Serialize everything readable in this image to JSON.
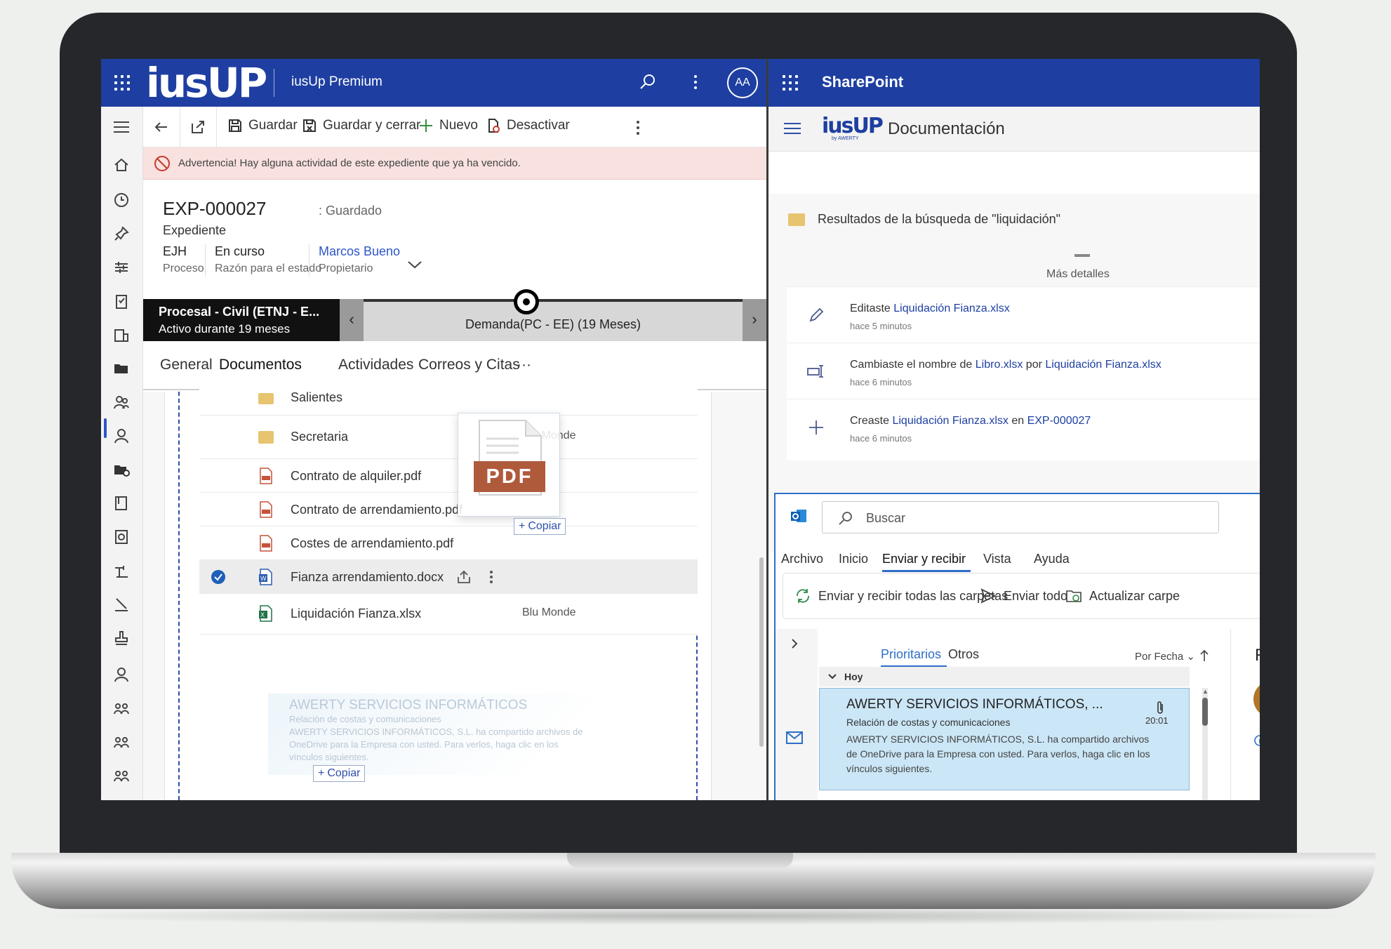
{
  "left_app": {
    "logo": "iusUP",
    "app_name": "iusUp Premium",
    "avatar_initials": "AA",
    "toolbar": {
      "save": "Guardar",
      "save_close": "Guardar y cerrar",
      "new": "Nuevo",
      "deactivate": "Desactivar"
    },
    "warning": "Advertencia! Hay alguna actividad de este expediente que ya ha vencido.",
    "record": {
      "id": "EXP-000027",
      "status": ": Guardado",
      "type": "Expediente",
      "fields": [
        {
          "value": "EJH",
          "label": "Proceso"
        },
        {
          "value": "En curso",
          "label": "Razón para el estado"
        },
        {
          "value": "Marcos Bueno",
          "label": "Propietario"
        }
      ]
    },
    "process_flow": {
      "stage_title": "Procesal - Civil (ETNJ - E...",
      "stage_subtitle": "Activo durante 19 meses",
      "current": "Demanda(PC - EE)  (19 Meses)"
    },
    "tabs": [
      "General",
      "Documentos",
      "Actividades",
      "Correos y Citas",
      "···"
    ],
    "documents": [
      {
        "name": "Salientes",
        "type": "folder",
        "owner": ""
      },
      {
        "name": "Secretaria",
        "type": "folder",
        "owner": "Blu Monde"
      },
      {
        "name": "Contrato de alquiler.pdf",
        "type": "pdf",
        "owner": ""
      },
      {
        "name": "Contrato de arrendamiento.pdf",
        "type": "pdf",
        "owner": ""
      },
      {
        "name": "Costes de arrendamiento.pdf",
        "type": "pdf",
        "owner": ""
      },
      {
        "name": "Fianza arrendamiento.docx",
        "type": "docx",
        "owner": ""
      },
      {
        "name": "Liquidación Fianza.xlsx",
        "type": "xlsx",
        "owner": "Blu Monde"
      }
    ],
    "drag_pdf": {
      "badge": "PDF",
      "copy_label": "Copiar"
    },
    "drag_email": {
      "title": "AWERTY SERVICIOS INFORMÁTICOS",
      "subject": "Relación de costas y comunicaciones",
      "body": "AWERTY SERVICIOS INFORMÁTICOS, S.L. ha compartido archivos de OneDrive para la Empresa con usted. Para verlos, haga clic en los vínculos siguientes.",
      "copy_label": "Copiar"
    }
  },
  "right_app": {
    "title": "SharePoint",
    "logo": "iusUP",
    "logo_sub": "by AWERTY",
    "page_title": "Documentación",
    "results_title": "Resultados de la búsqueda de \"liquidación\"",
    "more_details": "Más detalles",
    "activities": [
      {
        "icon": "pencil-icon",
        "pre": "Editaste ",
        "link1": "Liquidación Fianza.xlsx",
        "mid": "",
        "link2": "",
        "post": "",
        "time": "hace 5 minutos"
      },
      {
        "icon": "rename-icon",
        "pre": "Cambiaste el nombre de ",
        "link1": "Libro.xlsx",
        "mid": " por ",
        "link2": "Liquidación Fianza.xlsx",
        "post": "",
        "time": "hace 6 minutos"
      },
      {
        "icon": "plus-icon",
        "pre": "Creaste ",
        "link1": "Liquidación Fianza.xlsx",
        "mid": " en ",
        "link2": "EXP-000027",
        "post": "",
        "time": "hace 6 minutos"
      }
    ],
    "outlook": {
      "search_placeholder": "Buscar",
      "menu": [
        "Archivo",
        "Inicio",
        "Enviar y recibir",
        "Vista",
        "Ayuda"
      ],
      "ribbon": [
        "Enviar y recibir todas las carpetas",
        "Enviar todo",
        "Actualizar carpe"
      ],
      "tabs": [
        "Prioritarios",
        "Otros"
      ],
      "sort": "Por Fecha",
      "group": "Hoy",
      "mail": {
        "from": "AWERTY SERVICIOS INFORMÁTICOS, ...",
        "subject": "Relación de costas y comunicaciones",
        "time": "20:01",
        "body": "AWERTY SERVICIOS INFORMÁTICOS, S.L. ha compartido archivos de OneDrive para la Empresa con usted. Para verlos, haga clic en los vínculos siguientes."
      },
      "reading_letter": "R"
    }
  }
}
